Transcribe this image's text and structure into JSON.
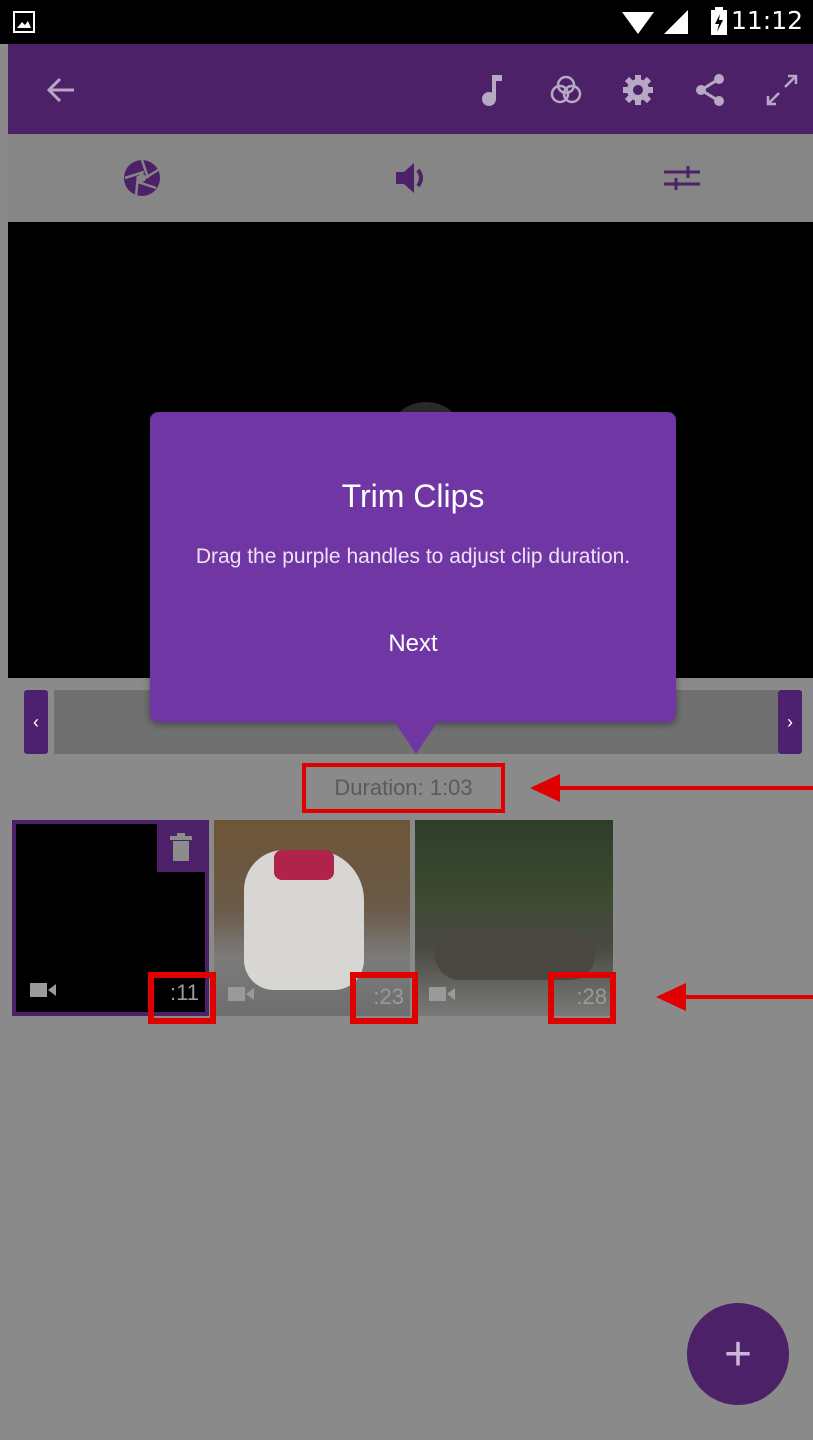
{
  "status_bar": {
    "time": "11:12"
  },
  "toolbar": {
    "icons": [
      "back-arrow-icon",
      "music-note-icon",
      "color-filter-icon",
      "settings-gear-icon",
      "share-icon",
      "fullscreen-icon"
    ]
  },
  "tools": {
    "icons": [
      "aperture-icon",
      "volume-icon",
      "sliders-icon"
    ]
  },
  "scrubber": {
    "prev_label": "‹",
    "next_label": "›"
  },
  "timeline": {
    "duration_label": "Duration: 1:03"
  },
  "clips": [
    {
      "duration": ":11",
      "selected": true
    },
    {
      "duration": ":23",
      "selected": false
    },
    {
      "duration": ":28",
      "selected": false
    }
  ],
  "popover": {
    "title": "Trim Clips",
    "message": "Drag the purple handles to adjust clip duration.",
    "next_label": "Next"
  },
  "fab": {
    "label": "+"
  },
  "colors": {
    "brand": "#4c2168",
    "popover": "#7036a4",
    "annotation": "#e00000"
  }
}
